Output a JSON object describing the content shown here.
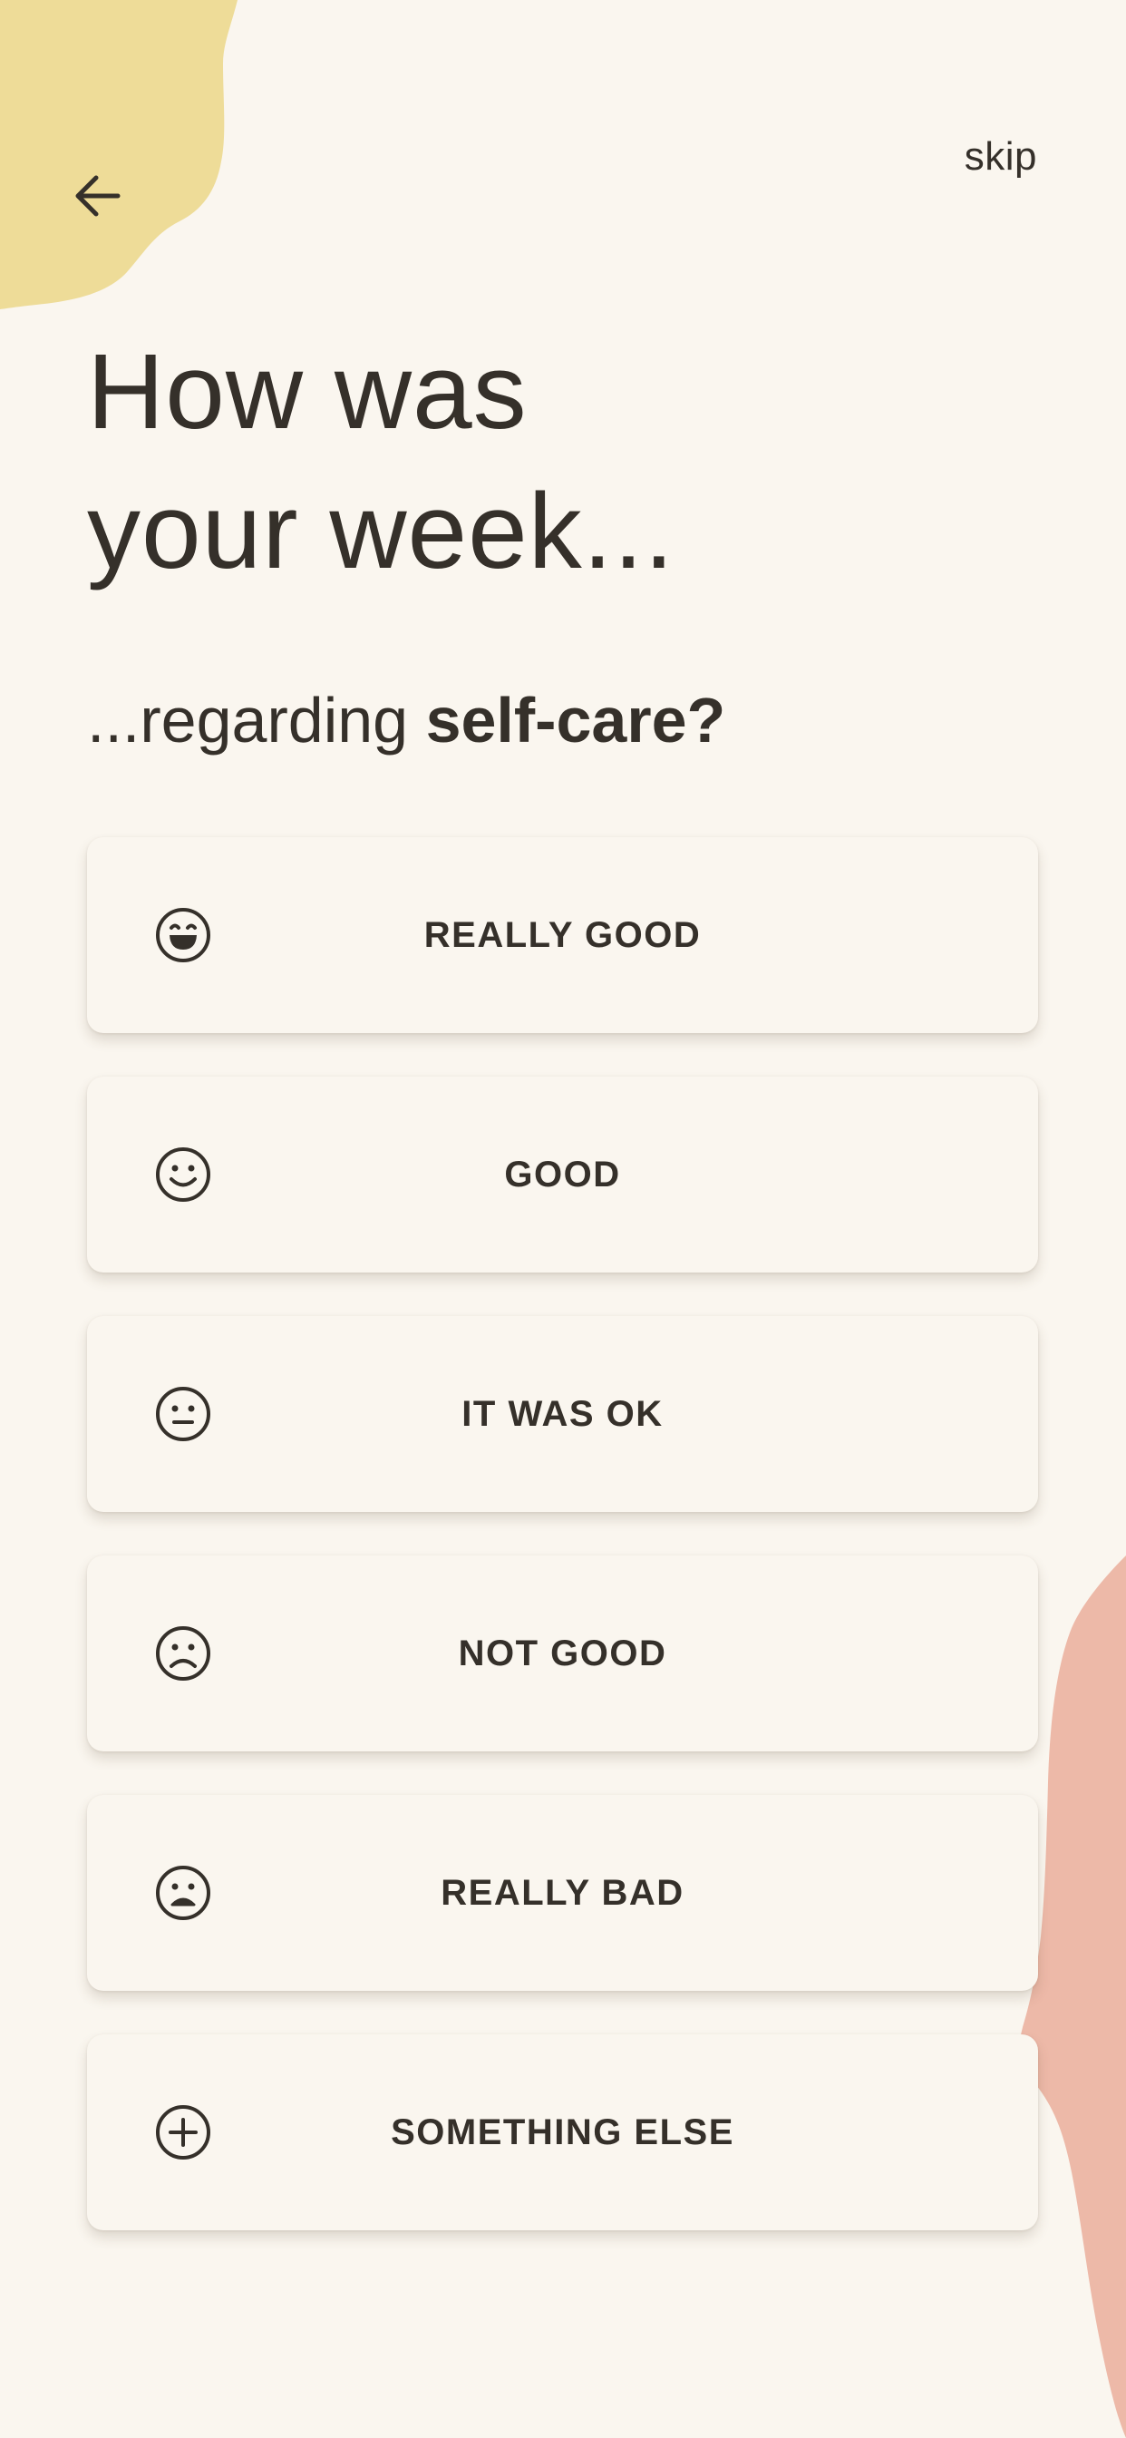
{
  "colors": {
    "background": "#FAF6EF",
    "text": "#35302A",
    "blob_yellow": "#EEDC98",
    "blob_pink": "#EDB9A8"
  },
  "header": {
    "back_icon": "arrow-left-icon",
    "skip_label": "skip"
  },
  "title": {
    "line1": "How was",
    "line2": "your week..."
  },
  "subtitle": {
    "prefix": "...regarding ",
    "topic": "self-care?"
  },
  "options": [
    {
      "label": "REALLY GOOD",
      "icon": "grinning-face-icon"
    },
    {
      "label": "GOOD",
      "icon": "smiling-face-icon"
    },
    {
      "label": "IT WAS OK",
      "icon": "neutral-face-icon"
    },
    {
      "label": "NOT GOOD",
      "icon": "frowning-face-icon"
    },
    {
      "label": "REALLY BAD",
      "icon": "sad-face-icon"
    },
    {
      "label": "SOMETHING ELSE",
      "icon": "plus-circle-icon"
    }
  ]
}
